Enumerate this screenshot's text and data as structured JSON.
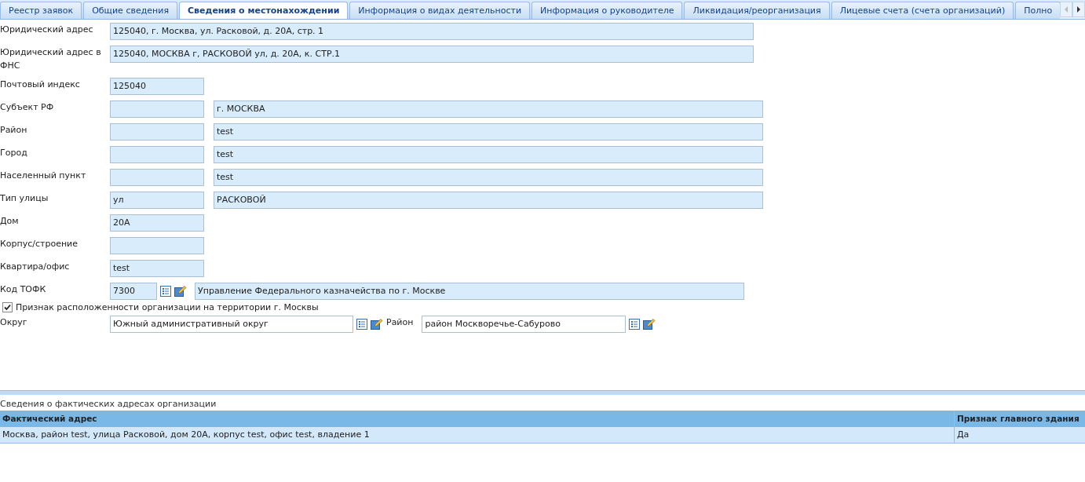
{
  "tabs": [
    {
      "label": "Реестр заявок",
      "selected": false
    },
    {
      "label": "Общие сведения",
      "selected": false
    },
    {
      "label": "Сведения о местонахождении",
      "selected": true
    },
    {
      "label": "Информация о видах деятельности",
      "selected": false
    },
    {
      "label": "Информация о руководителе",
      "selected": false
    },
    {
      "label": "Ликвидация/реорганизация",
      "selected": false
    },
    {
      "label": "Лицевые счета (счета организаций)",
      "selected": false
    },
    {
      "label": "Полно",
      "selected": false
    }
  ],
  "form": [
    {
      "label": "Юридический адрес",
      "kind": "wide",
      "value": "125040, г. Москва, ул. Расковой, д. 20А, стр. 1"
    },
    {
      "label": "Юридический адрес в ФНС",
      "kind": "wide",
      "value": "125040, МОСКВА г, РАСКОВОЙ ул, д. 20А, к. СТР.1"
    },
    {
      "label": "Почтовый индекс",
      "kind": "short",
      "value": "125040"
    },
    {
      "label": "Субъект РФ",
      "kind": "pair",
      "value": "г. МОСКВА"
    },
    {
      "label": "Район",
      "kind": "pair",
      "value": "test"
    },
    {
      "label": "Город",
      "kind": "pair",
      "value": "test"
    },
    {
      "label": "Населенный пункт",
      "kind": "pair",
      "value": "test"
    },
    {
      "label": "Тип улицы",
      "kind": "pair",
      "code": "ул",
      "value": "РАСКОВОЙ"
    },
    {
      "label": "Дом",
      "kind": "short",
      "value": "20А"
    },
    {
      "label": "Корпус/строение",
      "kind": "short"
    },
    {
      "label": "Квартира/офис",
      "kind": "short",
      "value": "test"
    },
    {
      "label": "Код ТОФК",
      "kind": "lookup",
      "code": "7300",
      "value": "Управление Федерального казначейства по г. Москве"
    }
  ],
  "moscow_flag": {
    "label": "Признак расположенности организации на территории г. Москвы",
    "checked": true
  },
  "district": {
    "label": "Округ",
    "value": "Южный административный округ",
    "area_label": "Район",
    "area_value": "район Москворечье-Сабурово"
  },
  "addresses": {
    "title": "Сведения о фактических адресах организации",
    "columns": [
      "Фактический адрес",
      "Признак главного здания"
    ],
    "rows": [
      [
        "Москва, район test, улица Расковой, дом 20А, корпус test, офис test, владение 1",
        "Да"
      ]
    ]
  }
}
